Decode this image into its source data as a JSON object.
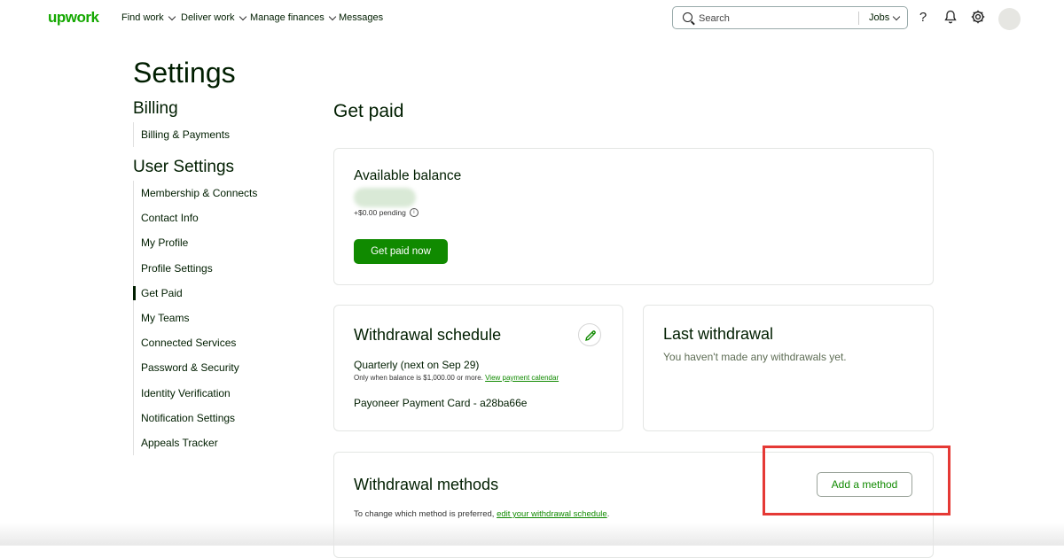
{
  "topbar": {
    "logo": "upwork",
    "nav": [
      {
        "label": "Find work",
        "dropdown": true
      },
      {
        "label": "Deliver work",
        "dropdown": true
      },
      {
        "label": "Manage finances",
        "dropdown": true
      },
      {
        "label": "Messages",
        "dropdown": false
      }
    ],
    "search_placeholder": "Search",
    "search_scope": "Jobs",
    "icons": [
      "search-icon",
      "help-icon",
      "bell-icon",
      "settings-icon",
      "avatar"
    ]
  },
  "page_title": "Settings",
  "sidebar": {
    "billing_heading": "Billing",
    "billing_items": [
      {
        "label": "Billing & Payments"
      }
    ],
    "user_heading": "User Settings",
    "user_items": [
      {
        "label": "Membership & Connects"
      },
      {
        "label": "Contact Info"
      },
      {
        "label": "My Profile"
      },
      {
        "label": "Profile Settings"
      },
      {
        "label": "Get Paid",
        "active": true
      },
      {
        "label": "My Teams"
      },
      {
        "label": "Connected Services"
      },
      {
        "label": "Password & Security"
      },
      {
        "label": "Identity Verification"
      },
      {
        "label": "Notification Settings"
      },
      {
        "label": "Appeals Tracker"
      }
    ]
  },
  "main": {
    "title": "Get paid",
    "balance": {
      "title": "Available balance",
      "pending": "+$0.00 pending",
      "button": "Get paid now"
    },
    "schedule": {
      "title": "Withdrawal schedule",
      "frequency": "Quarterly (next on Sep 29)",
      "condition": "Only when balance is $1,000.00 or more.",
      "calendar_link": "View payment calendar",
      "method": "Payoneer Payment Card - a28ba66e"
    },
    "last_withdrawal": {
      "title": "Last withdrawal",
      "message": "You haven't made any withdrawals yet."
    },
    "methods": {
      "title": "Withdrawal methods",
      "add_button": "Add a method",
      "helper_prefix": "To change which method is preferred,",
      "helper_link": "edit your withdrawal schedule",
      "helper_suffix": "."
    }
  },
  "colors": {
    "brand_green": "#14a800",
    "button_green": "#108a00",
    "highlight_red": "#e53935",
    "text_dark": "#001e00"
  }
}
